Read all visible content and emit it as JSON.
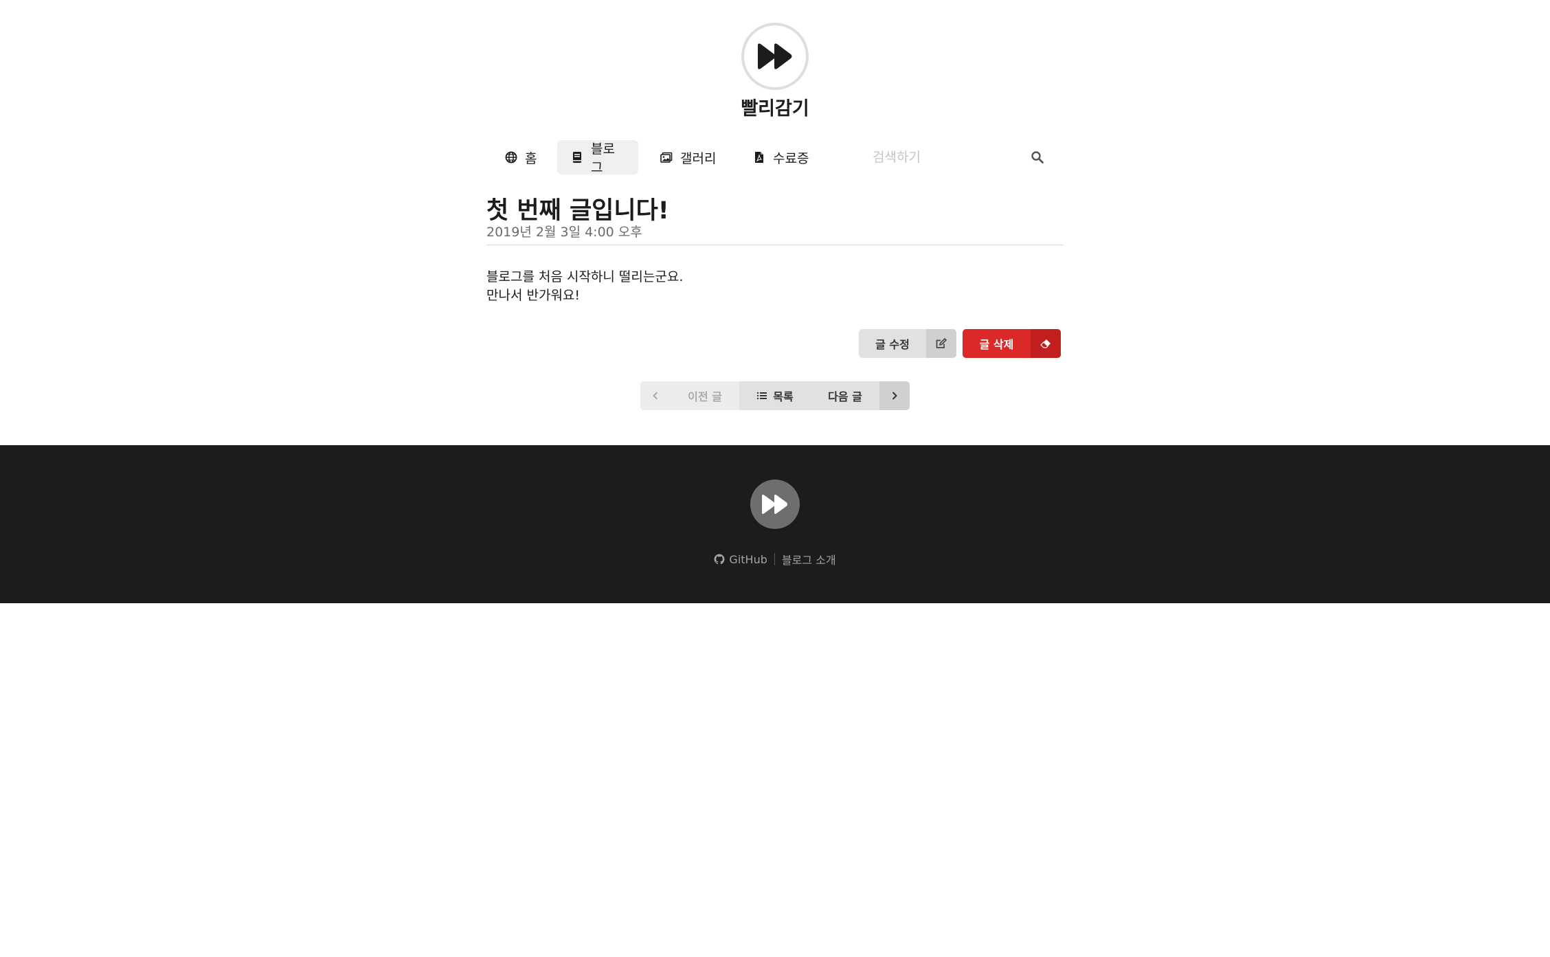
{
  "site": {
    "title": "빨리감기",
    "logo_icon": "fast-forward-icon"
  },
  "nav": {
    "items": [
      {
        "label": "홈",
        "icon": "globe-icon",
        "active": false
      },
      {
        "label": "블로그",
        "icon": "book-icon",
        "active": true
      },
      {
        "label": "갤러리",
        "icon": "images-icon",
        "active": false
      },
      {
        "label": "수료증",
        "icon": "file-pdf-icon",
        "active": false
      }
    ],
    "search": {
      "placeholder": "검색하기",
      "value": "",
      "icon": "search-icon"
    }
  },
  "post": {
    "title": "첫 번째 글입니다!",
    "date": "2019년 2월 3일 4:00 오후",
    "body": [
      "블로그를 처음 시작하니 떨리는군요.",
      "만나서 반가워요!"
    ]
  },
  "actions": {
    "edit": {
      "label": "글 수정",
      "icon": "edit-icon"
    },
    "delete": {
      "label": "글 삭제",
      "icon": "eraser-icon",
      "color": "#db2828"
    }
  },
  "pager": {
    "prev": {
      "label": "이전 글",
      "icon": "chevron-left-icon",
      "disabled": true
    },
    "list": {
      "label": "목록",
      "icon": "list-icon"
    },
    "next": {
      "label": "다음 글",
      "icon": "chevron-right-icon"
    }
  },
  "footer": {
    "background": "#1b1c1d",
    "links": [
      {
        "label": "GitHub",
        "icon": "github-icon"
      },
      {
        "label": "블로그 소개"
      }
    ]
  }
}
